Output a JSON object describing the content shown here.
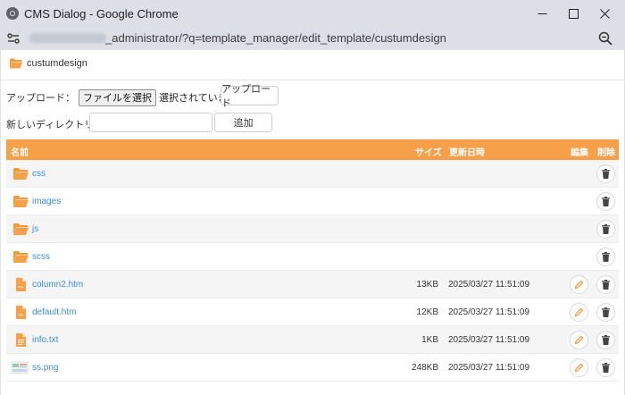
{
  "window": {
    "title": "CMS Dialog - Google Chrome"
  },
  "address": {
    "url_suffix": "_administrator/?q=template_manager/edit_template/custumdesign"
  },
  "breadcrumb": {
    "folder": "custumdesign"
  },
  "upload": {
    "label": "アップロード：",
    "file_button": "ファイルを選択",
    "no_file": "選択されていません",
    "submit": "アップロード"
  },
  "new_dir": {
    "label": "新しいディレクトリ：",
    "value": "",
    "add": "追加"
  },
  "table": {
    "headers": {
      "name": "名前",
      "size": "サイズ",
      "date": "更新日時",
      "edit": "編集",
      "delete": "削除"
    },
    "rows": [
      {
        "name": "css",
        "icon": "folder-icon",
        "size": "",
        "date": ""
      },
      {
        "name": "images",
        "icon": "folder-icon",
        "size": "",
        "date": ""
      },
      {
        "name": "js",
        "icon": "folder-icon",
        "size": "",
        "date": ""
      },
      {
        "name": "scss",
        "icon": "folder-icon",
        "size": "",
        "date": ""
      },
      {
        "name": "column2.htm",
        "icon": "html-file-icon",
        "size": "13KB",
        "date": "2025/03/27 11:51:09"
      },
      {
        "name": "default.htm",
        "icon": "html-file-icon",
        "size": "12KB",
        "date": "2025/03/27 11:51:09"
      },
      {
        "name": "info.txt",
        "icon": "text-file-icon",
        "size": "1KB",
        "date": "2025/03/27 11:51:09"
      },
      {
        "name": "ss.png",
        "icon": "image-thumbnail",
        "size": "248KB",
        "date": "2025/03/27 11:51:09"
      }
    ]
  },
  "colors": {
    "accent": "#f7a04a",
    "link": "#3a8fd9"
  }
}
